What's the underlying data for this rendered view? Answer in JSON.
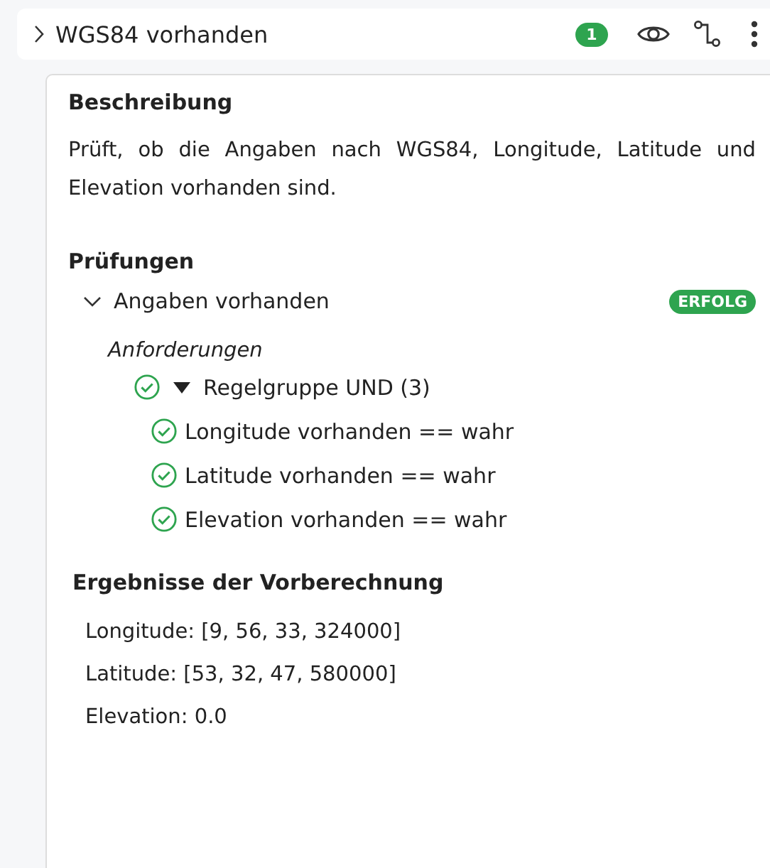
{
  "header": {
    "title": "WGS84 vorhanden",
    "expanded": false,
    "count": "1"
  },
  "description": {
    "heading": "Beschreibung",
    "text": "Prüft, ob die Angaben nach WGS84, Longitude, Latitude und Elevation vorhanden sind."
  },
  "checks": {
    "heading": "Prüfungen",
    "items": [
      {
        "title": "Angaben vorhanden",
        "expanded": true,
        "status": "ERFOLG",
        "requirements_label": "Anforderungen",
        "group": {
          "label": "Regelgruppe UND (3)",
          "passed": true,
          "expanded": true,
          "rules": [
            {
              "label": "Longitude vorhanden == wahr",
              "passed": true
            },
            {
              "label": "Latitude vorhanden == wahr",
              "passed": true
            },
            {
              "label": "Elevation vorhanden == wahr",
              "passed": true
            }
          ]
        }
      }
    ]
  },
  "results": {
    "heading": "Ergebnisse der Vorberechnung",
    "lines": [
      "Longitude: [9, 56, 33, 324000]",
      "Latitude: [53, 32, 47, 580000]",
      "Elevation: 0.0"
    ]
  }
}
